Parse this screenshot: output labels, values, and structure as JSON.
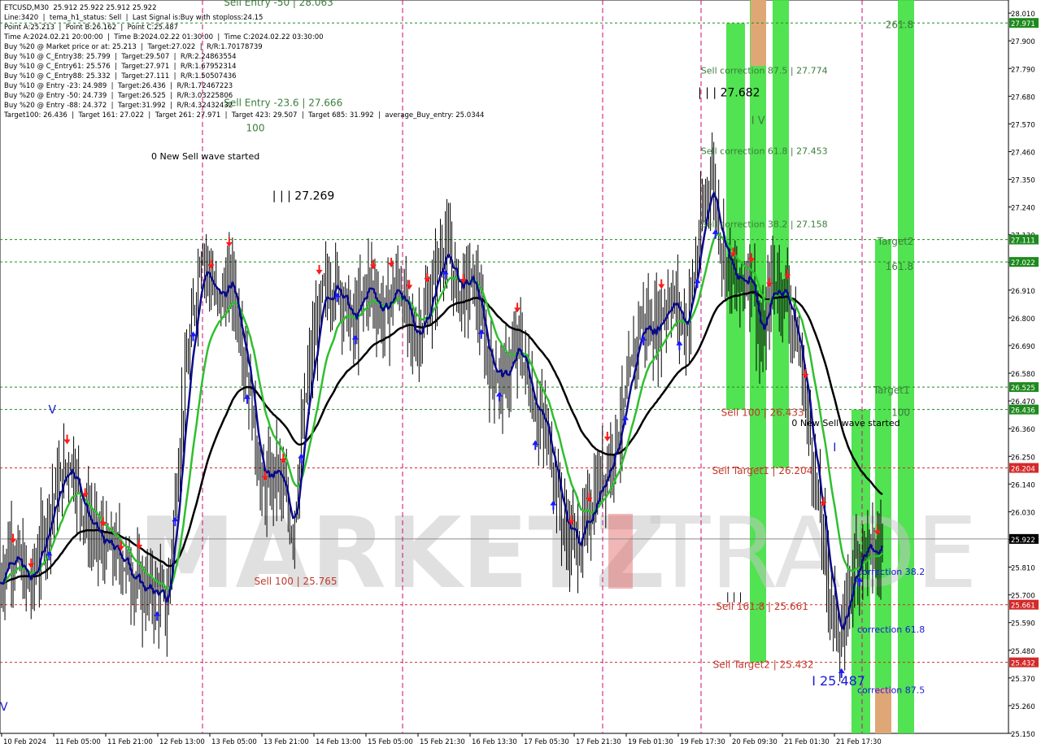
{
  "header": {
    "lines": [
      "ETCUSD,M30  25.912 25.922 25.912 25.922",
      "Line:3420  |  tema_h1_status: Sell  |  Last Signal is:Buy with stoploss:24.15",
      "Point A:25.213  |  Point B:26.162  |  Point C:25.487",
      "Time A:2024.02.21 20:00:00  |  Time B:2024.02.22 01:30:00  |  Time C:2024.02.22 03:30:00",
      "Buy %20 @ Market price or at: 25.213  |  Target:27.022  |  R/R:1.70178739",
      "Buy %10 @ C_Entry38: 25.799  |  Target:29.507  |  R/R:2.24863554",
      "Buy %10 @ C_Entry61: 25.576  |  Target:27.971  |  R/R:1.67952314",
      "Buy %10 @ C_Entry88: 25.332  |  Target:27.111  |  R/R:1.50507436",
      "Buy %10 @ Entry -23: 24.989  |  Target:26.436  |  R/R:1.72467223",
      "Buy %20 @ Entry -50: 24.739  |  Target:26.525  |  R/R:3.03225806",
      "Buy %20 @ Entry -88: 24.372  |  Target:31.992  |  R/R:4.32432432",
      "Target100: 26.436  |  Target 161: 27.022  |  Target 261: 27.971  |  Target 423: 29.507  |  Target 685: 31.992  |  average_Buy_entry: 25.0344"
    ]
  },
  "watermark": {
    "text_a": "MARKETZ",
    "text_b": "TRADE"
  },
  "chart_data": {
    "type": "candlestick",
    "symbol": "ETCUSD",
    "timeframe": "M30",
    "ylim": [
      25.15,
      28.062
    ],
    "y_ticks": [
      "28.010",
      "27.900",
      "27.790",
      "27.680",
      "27.570",
      "27.460",
      "27.350",
      "27.240",
      "27.130",
      "27.020",
      "26.910",
      "26.800",
      "26.690",
      "26.580",
      "26.470",
      "26.360",
      "26.250",
      "26.140",
      "26.030",
      "25.920",
      "25.810",
      "25.700",
      "25.590",
      "25.480",
      "25.370",
      "25.260",
      "25.150"
    ],
    "x_ticks": [
      "10 Feb 2024",
      "11 Feb 05:00",
      "11 Feb 21:00",
      "12 Feb 13:00",
      "13 Feb 05:00",
      "13 Feb 21:00",
      "14 Feb 13:00",
      "15 Feb 05:00",
      "15 Feb 21:30",
      "16 Feb 13:30",
      "17 Feb 05:30",
      "17 Feb 21:30",
      "19 Feb 01:30",
      "19 Feb 17:30",
      "20 Feb 09:30",
      "21 Feb 01:30",
      "21 Feb 17:30"
    ],
    "current_price": "25.922",
    "price_boxes": [
      {
        "value": "27.971",
        "color": "#1e8a1e"
      },
      {
        "value": "27.111",
        "color": "#1e8a1e"
      },
      {
        "value": "27.022",
        "color": "#1e8a1e"
      },
      {
        "value": "26.525",
        "color": "#1e8a1e"
      },
      {
        "value": "26.436",
        "color": "#1e8a1e"
      },
      {
        "value": "26.204",
        "color": "#d42a2a"
      },
      {
        "value": "25.661",
        "color": "#d42a2a"
      },
      {
        "value": "25.432",
        "color": "#d42a2a"
      }
    ],
    "annotations": [
      {
        "text": "Sell Entry -50 | 28.063",
        "price": 28.04,
        "time": 0.222,
        "color": "#3b7d3b",
        "size": 12
      },
      {
        "text": "Sell Entry -23.6 | 27.666",
        "price": 27.64,
        "time": 0.222,
        "color": "#3b7d3b",
        "size": 12
      },
      {
        "text": "100",
        "price": 27.54,
        "time": 0.244,
        "color": "#3b7d3b",
        "size": 12
      },
      {
        "text": "0 New Sell wave started",
        "price": 27.43,
        "time": 0.15,
        "color": "#000000",
        "size": 11
      },
      {
        "text": "| | | 27.269",
        "price": 27.27,
        "time": 0.27,
        "color": "#000000",
        "size": 14
      },
      {
        "text": "| | | 27.682",
        "price": 27.68,
        "time": 0.692,
        "color": "#000000",
        "size": 14
      },
      {
        "text": "Sell correction 87.5 | 27.774",
        "price": 27.77,
        "time": 0.695,
        "color": "#3b7d3b",
        "size": 11
      },
      {
        "text": "I V",
        "price": 27.57,
        "time": 0.745,
        "color": "#3b7d3b",
        "size": 13
      },
      {
        "text": "Sell correction 61.8 | 27.453",
        "price": 27.45,
        "time": 0.695,
        "color": "#3b7d3b",
        "size": 11
      },
      {
        "text": "Sell correction 38.2 | 27.158",
        "price": 27.16,
        "time": 0.695,
        "color": "#3b7d3b",
        "size": 11
      },
      {
        "text": "261.8",
        "price": 27.95,
        "time": 0.878,
        "color": "#3b7d3b",
        "size": 12
      },
      {
        "text": "Target2",
        "price": 27.09,
        "time": 0.87,
        "color": "#3b7d3b",
        "size": 12
      },
      {
        "text": "161.8",
        "price": 26.99,
        "time": 0.878,
        "color": "#3b7d3b",
        "size": 12
      },
      {
        "text": "Target1",
        "price": 26.5,
        "time": 0.866,
        "color": "#3b7d3b",
        "size": 12
      },
      {
        "text": "100",
        "price": 26.41,
        "time": 0.884,
        "color": "#3b7d3b",
        "size": 12
      },
      {
        "text": "Sell 100 | 26.433",
        "price": 26.41,
        "time": 0.715,
        "color": "#c0392b",
        "size": 12
      },
      {
        "text": "0 New Sell wave started",
        "price": 26.37,
        "time": 0.785,
        "color": "#000000",
        "size": 11
      },
      {
        "text": "Sell Target1 | 26.204",
        "price": 26.18,
        "time": 0.706,
        "color": "#c0392b",
        "size": 12
      },
      {
        "text": "Sell 100 | 25.765",
        "price": 25.74,
        "time": 0.252,
        "color": "#c0392b",
        "size": 12
      },
      {
        "text": "Sell 161.8 | 25.661",
        "price": 25.64,
        "time": 0.71,
        "color": "#c0392b",
        "size": 12
      },
      {
        "text": "Sell Target2 | 25.432",
        "price": 25.41,
        "time": 0.707,
        "color": "#c0392b",
        "size": 12
      },
      {
        "text": "correction 38.2",
        "price": 25.78,
        "time": 0.85,
        "color": "#1a1ad6",
        "size": 11
      },
      {
        "text": "correction 61.8",
        "price": 25.55,
        "time": 0.85,
        "color": "#1a1ad6",
        "size": 11
      },
      {
        "text": "correction 87.5",
        "price": 25.31,
        "time": 0.85,
        "color": "#1a1ad6",
        "size": 11
      },
      {
        "text": "I  25.487",
        "price": 25.34,
        "time": 0.805,
        "color": "#1a1ad6",
        "size": 16
      },
      {
        "text": "| | |",
        "price": 25.68,
        "time": 0.72,
        "color": "#000000",
        "size": 12
      },
      {
        "text": "V",
        "price": 26.42,
        "time": 0.048,
        "color": "#1a1ad6",
        "size": 14
      },
      {
        "text": "V",
        "price": 25.24,
        "time": 0.0,
        "color": "#1a1ad6",
        "size": 14
      },
      {
        "text": "I",
        "price": 26.27,
        "time": 0.826,
        "color": "#1a1ad6",
        "size": 14
      }
    ]
  },
  "colors": {
    "up": "#000000",
    "ema_fast": "#0a0a8c",
    "ema_mid": "#2fbf2f",
    "ema_slow": "#000000",
    "buy_arrow": "#1a1aff",
    "sell_arrow": "#ff1a1a",
    "zone_green": "#3ee03e",
    "zone_orange": "#f0a07a"
  }
}
